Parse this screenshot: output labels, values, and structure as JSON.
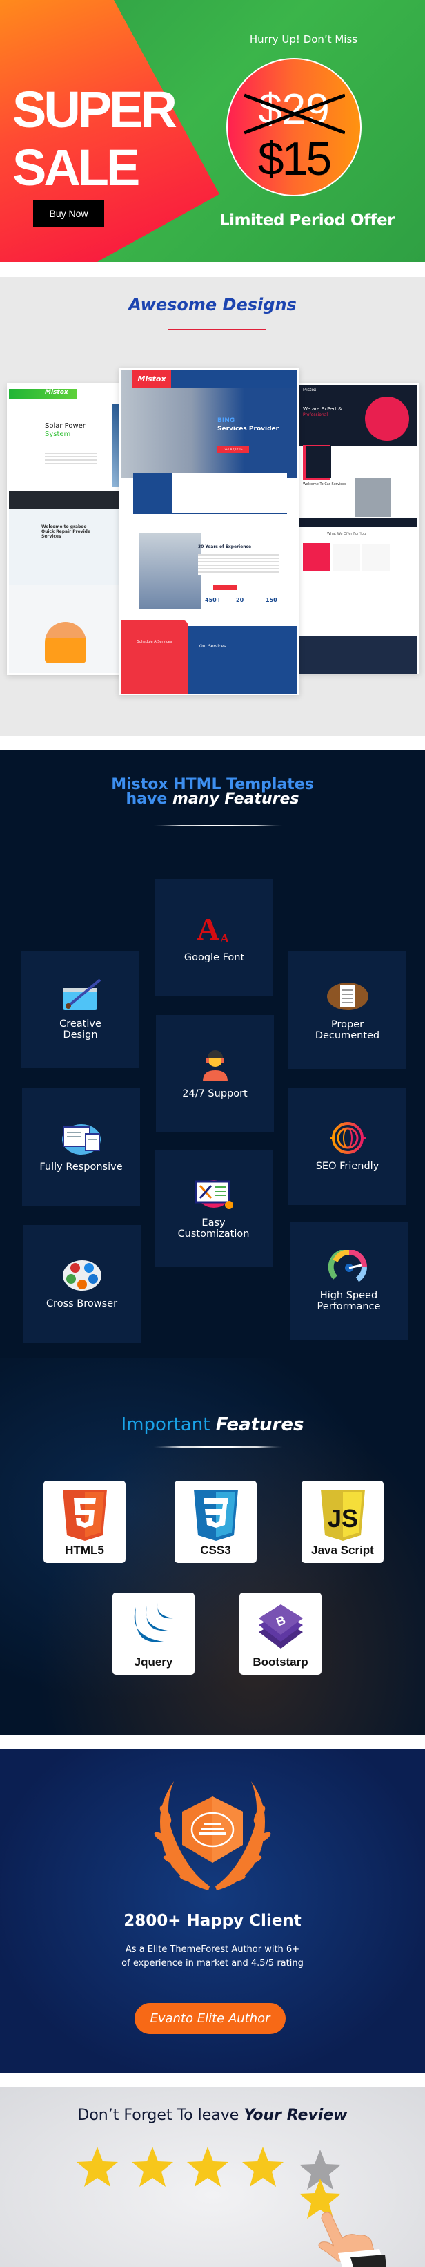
{
  "banner": {
    "headline_line1": "SUPER",
    "headline_line2": "SALE",
    "buy_label": "Buy Now",
    "hurry": "Hurry Up! Don’t Miss",
    "old_price": "$29",
    "new_price": "$15",
    "offer": "Limited Period Offer"
  },
  "designs": {
    "title": "Awesome Designs",
    "mockups": {
      "left": {
        "brand": "Mistox",
        "hero_title1": "Solar Power",
        "hero_title2": "System",
        "welcome": "Welcome to graboo Quick Repair Provide Services"
      },
      "center": {
        "brand": "Mistox",
        "hero_title1": "BING",
        "hero_title2": "Services Provider",
        "cta": "GET A QUOTE",
        "experience": "30 Years of Experience",
        "stats": [
          "450+",
          "20+",
          "150"
        ],
        "schedule": "Schedule A Services",
        "services": "Our Services"
      },
      "right": {
        "brand": "Mistox",
        "hero_title1": "We are ExPert &",
        "hero_title2": "Professional",
        "welcome": "Welcome To Car Services",
        "offer": "What We Offer For You"
      }
    }
  },
  "features": {
    "title_line1": "Mistox HTML Templates",
    "title_line2_a": "have ",
    "title_line2_b": "many Features",
    "items": [
      {
        "label": "Google Font",
        "icon": "font-icon"
      },
      {
        "label": "Creative Design",
        "icon": "paintbrush-icon"
      },
      {
        "label": "Proper Decumented",
        "icon": "clipboard-icon"
      },
      {
        "label": "24/7 Support",
        "icon": "support-agent-icon"
      },
      {
        "label": "Fully Responsive",
        "icon": "devices-icon"
      },
      {
        "label": "SEO Friendly",
        "icon": "globe-target-icon"
      },
      {
        "label": "Easy Customization",
        "icon": "tools-monitor-icon"
      },
      {
        "label": "Cross Browser",
        "icon": "browsers-icon"
      },
      {
        "label": "High Speed Performance",
        "icon": "speedometer-icon"
      }
    ],
    "important_a": "Important ",
    "important_b": "Features",
    "tech": [
      {
        "label": "HTML5",
        "color": "#e44d26"
      },
      {
        "label": "CSS3",
        "color": "#1572b6"
      },
      {
        "label": "Java Script",
        "color": "#f0db4f"
      },
      {
        "label": "Jquery",
        "color": "#0769ad"
      },
      {
        "label": "Bootstarp",
        "color": "#7952b3"
      }
    ]
  },
  "award": {
    "title": "2800+ Happy Client",
    "line1": "As a Elite ThemeForest Author with 6+",
    "line2": "of experience in market and 4.5/5 rating",
    "button": "Evanto Elite Author"
  },
  "review": {
    "title_a": "Don’t Forget To leave ",
    "title_b": "Your Review",
    "rating": 4,
    "max_rating": 5
  }
}
